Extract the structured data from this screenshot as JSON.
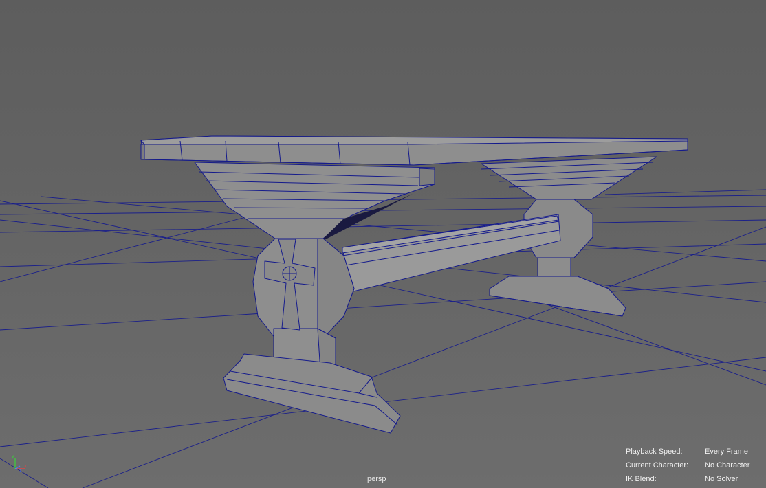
{
  "viewport": {
    "camera": "persp",
    "grid_color": "#1a1f8a",
    "mesh_fill": "#8f8f8f",
    "mesh_wire": "#141a8c",
    "background": "#636363"
  },
  "hud": {
    "rows": [
      {
        "key": "Playback Speed:",
        "value": "Every Frame"
      },
      {
        "key": "Current Character:",
        "value": "No Character"
      },
      {
        "key": "IK Blend:",
        "value": "No Solver"
      }
    ]
  },
  "axis_gizmo": {
    "x": "x",
    "y": "y",
    "z": "z"
  }
}
